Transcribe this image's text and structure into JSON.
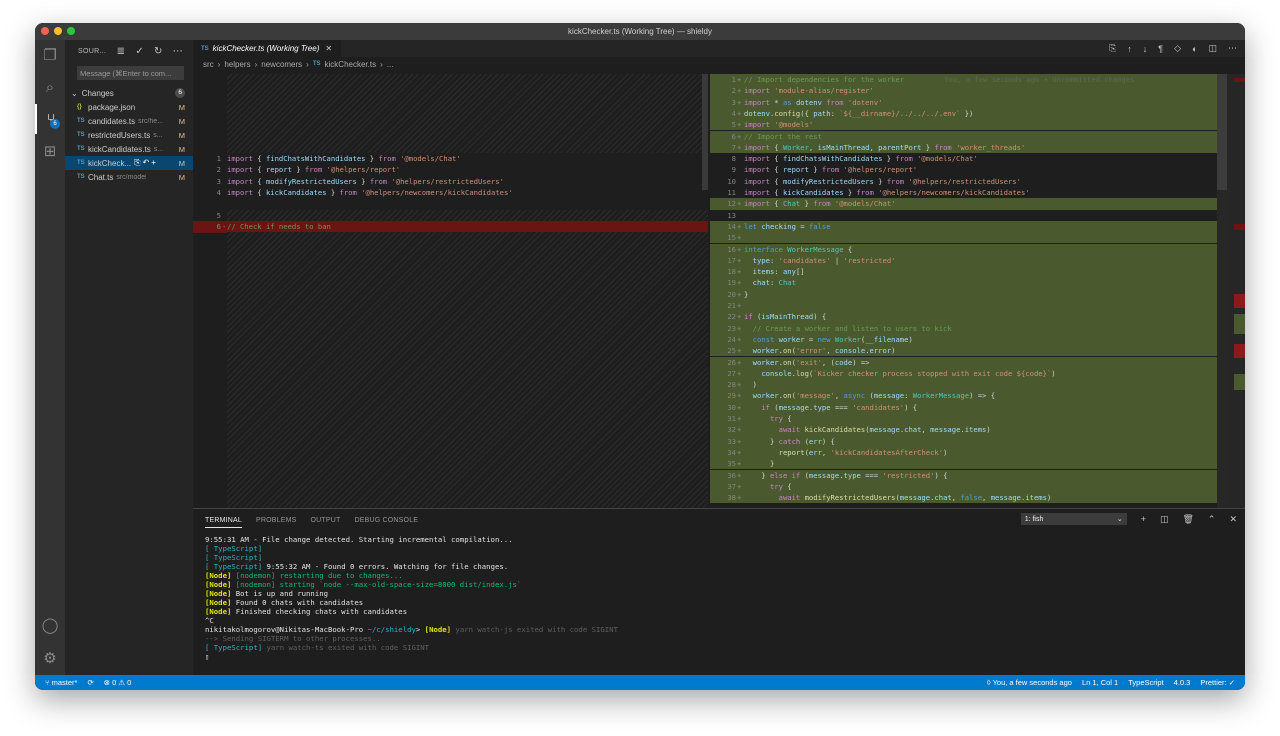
{
  "window": {
    "title": "kickChecker.ts (Working Tree) — shieldy"
  },
  "activity_bar": {
    "scm_badge": "6"
  },
  "sidebar": {
    "title": "SOUR...",
    "message_placeholder": "Message (⌘Enter to com...",
    "changes_label": "Changes",
    "changes_count": "6",
    "files": [
      {
        "icon": "{}",
        "name": "package.json",
        "path": "",
        "status": "M"
      },
      {
        "icon": "TS",
        "name": "candidates.ts",
        "path": "src/he...",
        "status": "M"
      },
      {
        "icon": "TS",
        "name": "restrictedUsers.ts",
        "path": "s...",
        "status": "M"
      },
      {
        "icon": "TS",
        "name": "kickCandidates.ts",
        "path": "s...",
        "status": "M"
      },
      {
        "icon": "TS",
        "name": "kickCheck...",
        "path": "",
        "status": "M"
      },
      {
        "icon": "TS",
        "name": "Chat.ts",
        "path": "src/models",
        "status": "M"
      }
    ]
  },
  "editor": {
    "tab_label": "kickChecker.ts (Working Tree)",
    "tab_icon": "TS",
    "breadcrumb": [
      "src",
      "helpers",
      "newcomers",
      "kickChecker.ts",
      "..."
    ],
    "blame": "You, a few seconds ago • Uncommitted changes",
    "left_lines": [
      {
        "n": "1",
        "m": "",
        "code": "import { findChatsWithCandidates } from '@models/Chat'"
      },
      {
        "n": "2",
        "m": "",
        "code": "import { report } from '@helpers/report'"
      },
      {
        "n": "3",
        "m": "",
        "code": "import { modifyRestrictedUsers } from '@helpers/restrictedUsers'"
      },
      {
        "n": "4",
        "m": "",
        "code": "import { kickCandidates } from '@helpers/newcomers/kickCandidates'"
      },
      {
        "n": "5",
        "m": "",
        "code": ""
      },
      {
        "n": "6",
        "m": "-",
        "code": "// Check if needs to ban"
      }
    ],
    "right_lines": [
      {
        "n": "1",
        "m": "+",
        "code": "// Import dependencies for the worker"
      },
      {
        "n": "2",
        "m": "+",
        "code": "import 'module-alias/register'"
      },
      {
        "n": "3",
        "m": "+",
        "code": "import * as dotenv from 'dotenv'"
      },
      {
        "n": "4",
        "m": "+",
        "code": "dotenv.config({ path: `${__dirname}/../../../.env` })"
      },
      {
        "n": "5",
        "m": "+",
        "code": "import '@models'"
      },
      {
        "n": "6",
        "m": "+",
        "code": "// Import the rest"
      },
      {
        "n": "7",
        "m": "+",
        "code": "import { Worker, isMainThread, parentPort } from 'worker_threads'"
      },
      {
        "n": "8",
        "m": "",
        "code": "import { findChatsWithCandidates } from '@models/Chat'"
      },
      {
        "n": "9",
        "m": "",
        "code": "import { report } from '@helpers/report'"
      },
      {
        "n": "10",
        "m": "",
        "code": "import { modifyRestrictedUsers } from '@helpers/restrictedUsers'"
      },
      {
        "n": "11",
        "m": "",
        "code": "import { kickCandidates } from '@helpers/newcomers/kickCandidates'"
      },
      {
        "n": "12",
        "m": "+",
        "code": "import { Chat } from '@models/Chat'"
      },
      {
        "n": "13",
        "m": "",
        "code": ""
      },
      {
        "n": "14",
        "m": "+",
        "code": "let checking = false"
      },
      {
        "n": "15",
        "m": "+",
        "code": ""
      },
      {
        "n": "16",
        "m": "+",
        "code": "interface WorkerMessage {"
      },
      {
        "n": "17",
        "m": "+",
        "code": "  type: 'candidates' | 'restricted'"
      },
      {
        "n": "18",
        "m": "+",
        "code": "  items: any[]"
      },
      {
        "n": "19",
        "m": "+",
        "code": "  chat: Chat"
      },
      {
        "n": "20",
        "m": "+",
        "code": "}"
      },
      {
        "n": "21",
        "m": "+",
        "code": ""
      },
      {
        "n": "22",
        "m": "+",
        "code": "if (isMainThread) {"
      },
      {
        "n": "23",
        "m": "+",
        "code": "  // Create a worker and listen to users to kick"
      },
      {
        "n": "24",
        "m": "+",
        "code": "  const worker = new Worker(__filename)"
      },
      {
        "n": "25",
        "m": "+",
        "code": "  worker.on('error', console.error)"
      },
      {
        "n": "26",
        "m": "+",
        "code": "  worker.on('exit', (code) =>"
      },
      {
        "n": "27",
        "m": "+",
        "code": "    console.log(`Kicker checker process stopped with exit code ${code}`)"
      },
      {
        "n": "28",
        "m": "+",
        "code": "  )"
      },
      {
        "n": "29",
        "m": "+",
        "code": "  worker.on('message', async (message: WorkerMessage) => {"
      },
      {
        "n": "30",
        "m": "+",
        "code": "    if (message.type === 'candidates') {"
      },
      {
        "n": "31",
        "m": "+",
        "code": "      try {"
      },
      {
        "n": "32",
        "m": "+",
        "code": "        await kickCandidates(message.chat, message.items)"
      },
      {
        "n": "33",
        "m": "+",
        "code": "      } catch (err) {"
      },
      {
        "n": "34",
        "m": "+",
        "code": "        report(err, 'kickCandidatesAfterCheck')"
      },
      {
        "n": "35",
        "m": "+",
        "code": "      }"
      },
      {
        "n": "36",
        "m": "+",
        "code": "    } else if (message.type === 'restricted') {"
      },
      {
        "n": "37",
        "m": "+",
        "code": "      try {"
      },
      {
        "n": "38",
        "m": "+",
        "code": "        await modifyRestrictedUsers(message.chat, false, message.items)"
      }
    ]
  },
  "panel": {
    "tabs": [
      "TERMINAL",
      "PROBLEMS",
      "OUTPUT",
      "DEBUG CONSOLE"
    ],
    "terminal_select": "1: fish",
    "terminal_lines": [
      [
        {
          "t": "9:55:31 AM - File change detected. Starting incremental compilation...",
          "c": ""
        }
      ],
      [
        {
          "t": "[ TypeScript]",
          "c": "tcyan"
        }
      ],
      [
        {
          "t": "[ TypeScript]",
          "c": "tcyan"
        }
      ],
      [
        {
          "t": "[ TypeScript]",
          "c": "tcyan"
        },
        {
          "t": " 9:55:32 AM - Found 0 errors. Watching for file changes.",
          "c": ""
        }
      ],
      [
        {
          "t": "[Node]",
          "c": "tyel"
        },
        {
          "t": " [nodemon] restarting due to changes...",
          "c": "tgrn"
        }
      ],
      [
        {
          "t": "[Node]",
          "c": "tyel"
        },
        {
          "t": " [nodemon] starting `node --max-old-space-size=8000 dist/index.js`",
          "c": "tgrn"
        }
      ],
      [
        {
          "t": "[Node]",
          "c": "tyel"
        },
        {
          "t": " Bot is up and running",
          "c": ""
        }
      ],
      [
        {
          "t": "[Node]",
          "c": "tyel"
        },
        {
          "t": " Found 0 chats with candidates",
          "c": ""
        }
      ],
      [
        {
          "t": "[Node]",
          "c": "tyel"
        },
        {
          "t": " Finished checking chats with candidates",
          "c": ""
        }
      ],
      [
        {
          "t": "^C",
          "c": ""
        }
      ],
      [
        {
          "t": "nikitakolmogorov@Nikitas-MacBook-Pro",
          "c": "tuser"
        },
        {
          "t": " ~/c/shieldy",
          "c": "tpath"
        },
        {
          "t": "> ",
          "c": ""
        },
        {
          "t": "[Node]",
          "c": "tyel"
        },
        {
          "t": " yarn watch-js exited with code SIGINT",
          "c": "tdim"
        }
      ],
      [
        {
          "t": "--> Sending SIGTERM to other processes..",
          "c": "tdim"
        }
      ],
      [
        {
          "t": "[ TypeScript]",
          "c": "tcyan"
        },
        {
          "t": " yarn watch-ts exited with code SIGINT",
          "c": "tdim"
        }
      ],
      [
        {
          "t": "▯",
          "c": ""
        }
      ]
    ]
  },
  "status_bar": {
    "branch": "master*",
    "problems": "⊗ 0 ⚠ 0",
    "blame": "You, a few seconds ago",
    "position": "Ln 1, Col 1",
    "language": "TypeScript",
    "version": "4.0.3",
    "prettier": "Prettier: ✓"
  },
  "colors": {
    "added_bg": "#4b5a2e",
    "removed_bg": "#6b1414",
    "accent": "#007acc"
  }
}
